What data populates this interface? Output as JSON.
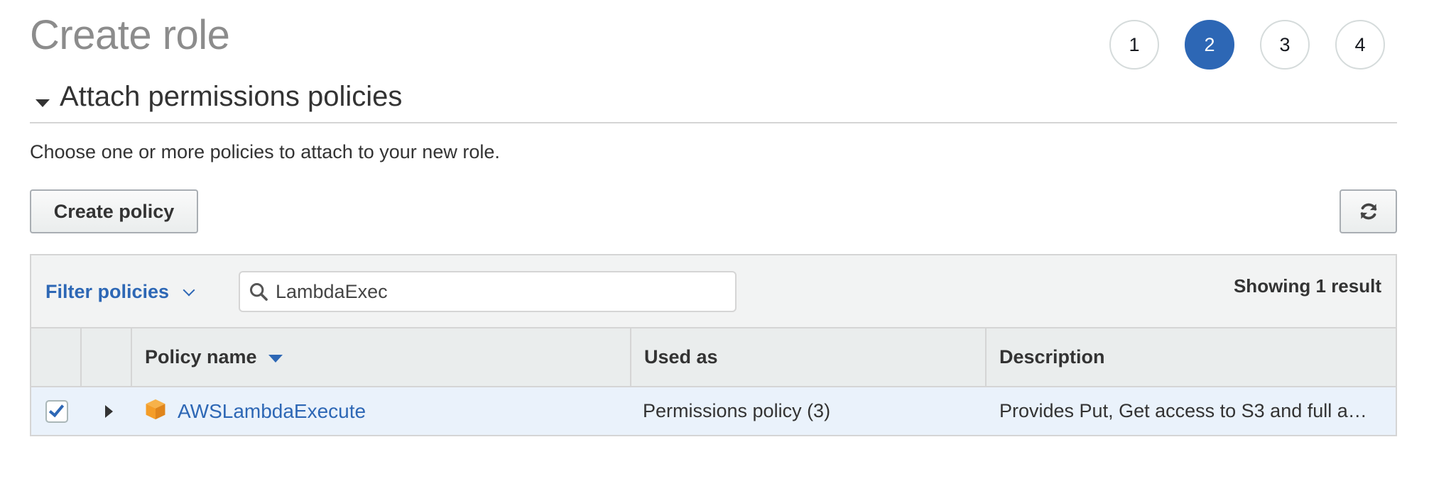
{
  "page": {
    "title": "Create role"
  },
  "steps": [
    {
      "label": "1",
      "active": false
    },
    {
      "label": "2",
      "active": true
    },
    {
      "label": "3",
      "active": false
    },
    {
      "label": "4",
      "active": false
    }
  ],
  "section": {
    "title": "Attach permissions policies",
    "description": "Choose one or more policies to attach to your new role."
  },
  "buttons": {
    "create_policy": "Create policy",
    "refresh_icon": "refresh-icon"
  },
  "toolbar": {
    "filter_label": "Filter policies",
    "search_value": "LambdaExec",
    "result_count": "Showing 1 result"
  },
  "table": {
    "columns": [
      "Policy name",
      "Used as",
      "Description"
    ],
    "rows": [
      {
        "checked": true,
        "policy_name": "AWSLambdaExecute",
        "used_as": "Permissions policy (3)",
        "description": "Provides Put, Get access to S3 and full a…"
      }
    ]
  },
  "colors": {
    "accent": "#2d67b5",
    "policy_icon": "#f49d28",
    "row_selected": "#eaf2fb"
  }
}
